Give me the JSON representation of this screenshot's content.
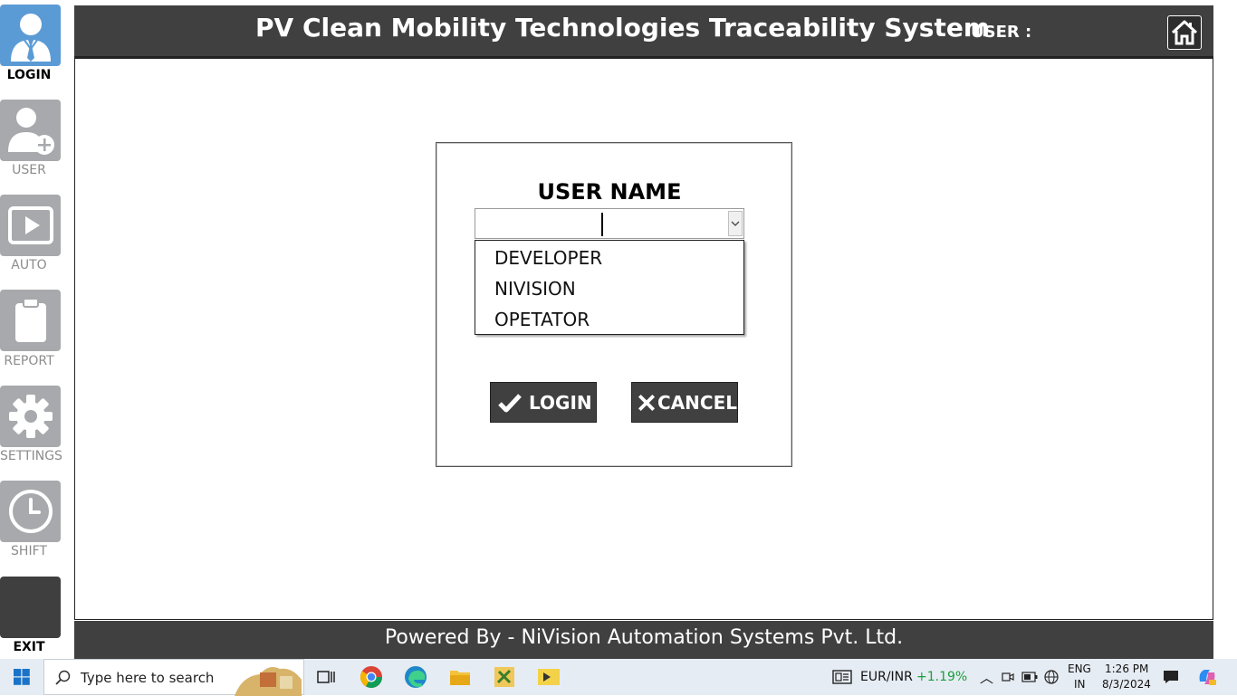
{
  "header": {
    "title": "PV Clean Mobility Technologies Traceability System",
    "user_label": "USER :"
  },
  "sidebar": {
    "items": [
      {
        "label": "LOGIN",
        "icon": "user-tie-icon",
        "active": true
      },
      {
        "label": "USER",
        "icon": "add-user-icon"
      },
      {
        "label": "AUTO",
        "icon": "play-icon"
      },
      {
        "label": "REPORT",
        "icon": "clipboard-icon"
      },
      {
        "label": "SETTINGS",
        "icon": "gear-icon"
      },
      {
        "label": "SHIFT",
        "icon": "clock-icon"
      },
      {
        "label": "EXIT",
        "icon": "exit-icon"
      }
    ]
  },
  "login": {
    "username_label": "USER NAME",
    "username_value": "",
    "options": [
      "DEVELOPER",
      "NIVISION",
      "OPETATOR"
    ],
    "login_label": "LOGIN",
    "cancel_label": "CANCEL"
  },
  "footer": {
    "text": "Powered By - NiVision Automation Systems Pvt. Ltd."
  },
  "taskbar": {
    "search_placeholder": "Type here to search",
    "ticker_name": "EUR/INR",
    "ticker_change": "+1.19%",
    "lang_line1": "ENG",
    "lang_line2": "IN",
    "time": "1:26 PM",
    "date": "8/3/2024"
  },
  "colors": {
    "header_bg": "#404040",
    "sidebar_active": "#5b9bd5",
    "sidebar_inactive": "#a7a9ac",
    "ticker_positive": "#1a9e3c"
  }
}
